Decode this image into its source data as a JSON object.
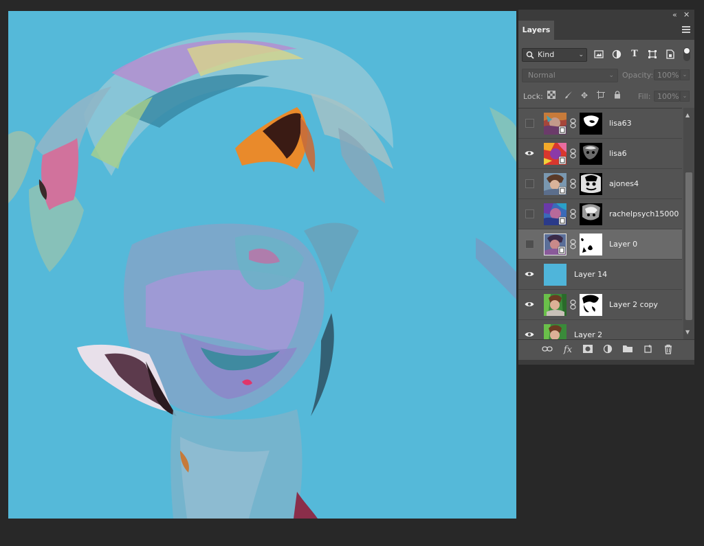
{
  "window": {
    "collapse_icon": "double-chevron-icon",
    "close_icon": "close-icon"
  },
  "panel": {
    "tab_label": "Layers",
    "menu_icon": "hamburger-menu-icon"
  },
  "filter": {
    "kind_label": "Kind",
    "icons": [
      "pixel-filter-icon",
      "adjustment-filter-icon",
      "type-filter-icon",
      "shape-filter-icon",
      "smart-object-filter-icon"
    ]
  },
  "blend": {
    "mode": "Normal",
    "opacity_label": "Opacity:",
    "opacity_value": "100%"
  },
  "lock": {
    "label": "Lock:",
    "fill_label": "Fill:",
    "fill_value": "100%",
    "icons": [
      "lock-transparent-icon",
      "lock-paint-icon",
      "lock-position-icon",
      "lock-artboard-icon",
      "lock-all-icon"
    ]
  },
  "layers": [
    {
      "name": "lisa63",
      "visible": false,
      "has_mask": true,
      "selected": false
    },
    {
      "name": "lisa6",
      "visible": true,
      "has_mask": true,
      "selected": false
    },
    {
      "name": "ajones4",
      "visible": false,
      "has_mask": true,
      "selected": false
    },
    {
      "name": "rachelpsych15000",
      "visible": false,
      "has_mask": true,
      "selected": false
    },
    {
      "name": "Layer 0",
      "visible": false,
      "has_mask": true,
      "selected": true
    },
    {
      "name": "Layer 14",
      "visible": true,
      "has_mask": false,
      "selected": false
    },
    {
      "name": "Layer 2 copy",
      "visible": true,
      "has_mask": true,
      "selected": false
    },
    {
      "name": "Layer 2",
      "visible": true,
      "has_mask": false,
      "selected": false
    }
  ],
  "bottom_icons": [
    "link-layers-icon",
    "fx-icon",
    "add-mask-icon",
    "adjustment-layer-icon",
    "new-group-icon",
    "new-layer-icon",
    "delete-icon"
  ],
  "fx_label": "fx",
  "colors": {
    "canvas_bg": "#55b9d9",
    "layer14_fill": "#4fb5da",
    "panel_bg": "#535353",
    "app_bg": "#282828"
  }
}
